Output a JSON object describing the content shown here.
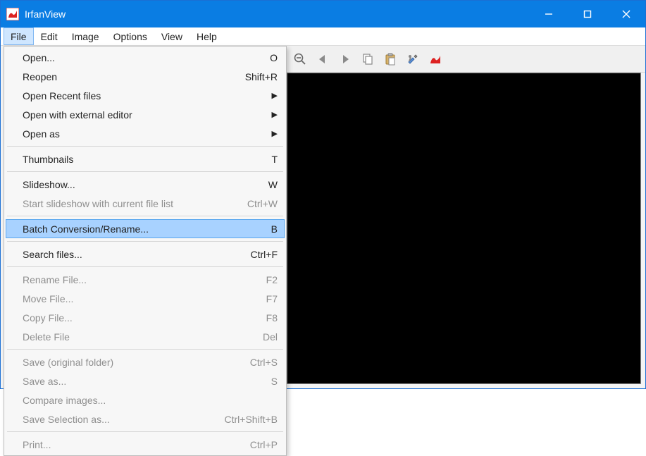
{
  "titlebar": {
    "app_name": "IrfanView"
  },
  "menubar": {
    "items": [
      "File",
      "Edit",
      "Image",
      "Options",
      "View",
      "Help"
    ],
    "open_index": 0
  },
  "file_menu": {
    "groups": [
      [
        {
          "label": "Open...",
          "accel": "O",
          "enabled": true,
          "sub": false
        },
        {
          "label": "Reopen",
          "accel": "Shift+R",
          "enabled": true,
          "sub": false
        },
        {
          "label": "Open Recent files",
          "accel": "",
          "enabled": true,
          "sub": true
        },
        {
          "label": "Open with external editor",
          "accel": "",
          "enabled": true,
          "sub": true
        },
        {
          "label": "Open as",
          "accel": "",
          "enabled": true,
          "sub": true
        }
      ],
      [
        {
          "label": "Thumbnails",
          "accel": "T",
          "enabled": true,
          "sub": false
        }
      ],
      [
        {
          "label": "Slideshow...",
          "accel": "W",
          "enabled": true,
          "sub": false
        },
        {
          "label": "Start slideshow with current file list",
          "accel": "Ctrl+W",
          "enabled": false,
          "sub": false
        }
      ],
      [
        {
          "label": "Batch Conversion/Rename...",
          "accel": "B",
          "enabled": true,
          "sub": false,
          "highlight": true
        }
      ],
      [
        {
          "label": "Search files...",
          "accel": "Ctrl+F",
          "enabled": true,
          "sub": false
        }
      ],
      [
        {
          "label": "Rename File...",
          "accel": "F2",
          "enabled": false,
          "sub": false
        },
        {
          "label": "Move File...",
          "accel": "F7",
          "enabled": false,
          "sub": false
        },
        {
          "label": "Copy File...",
          "accel": "F8",
          "enabled": false,
          "sub": false
        },
        {
          "label": "Delete File",
          "accel": "Del",
          "enabled": false,
          "sub": false
        }
      ],
      [
        {
          "label": "Save (original folder)",
          "accel": "Ctrl+S",
          "enabled": false,
          "sub": false
        },
        {
          "label": "Save as...",
          "accel": "S",
          "enabled": false,
          "sub": false
        },
        {
          "label": "Compare images...",
          "accel": "",
          "enabled": false,
          "sub": false
        },
        {
          "label": "Save Selection as...",
          "accel": "Ctrl+Shift+B",
          "enabled": false,
          "sub": false
        }
      ],
      [
        {
          "label": "Print...",
          "accel": "Ctrl+P",
          "enabled": false,
          "sub": false
        }
      ]
    ]
  },
  "toolbar": {
    "buttons": [
      "zoom-out",
      "prev",
      "next",
      "copy",
      "paste",
      "settings",
      "mascot"
    ]
  }
}
